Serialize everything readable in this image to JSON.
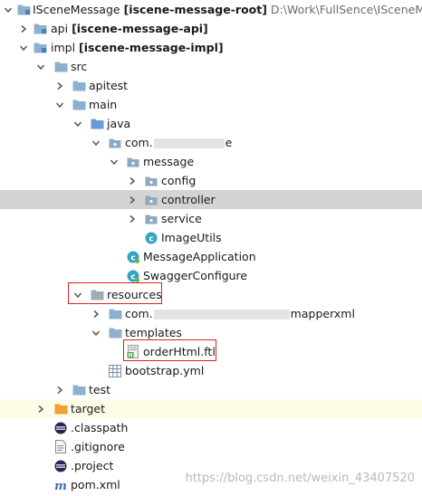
{
  "colors": {
    "folder": "#8fb0cc",
    "source_folder": "#6b9bd6",
    "package": "#8ea8bf",
    "resources_folder": "#c7a76a",
    "excluded_folder": "#f0a030",
    "class_icon": "#34a4c4",
    "selection": "#d4d4d4",
    "highlight_box": "#d82121"
  },
  "tree": {
    "root": {
      "name": "ISceneMessage",
      "module": "[iscene-message-root]",
      "path": "D:\\Work\\FullSence\\ISceneMessa"
    },
    "api": {
      "name": "api",
      "module": "[iscene-message-api]"
    },
    "impl": {
      "name": "impl",
      "module": "[iscene-message-impl]"
    },
    "src": "src",
    "apitest": "apitest",
    "main": "main",
    "java": "java",
    "com_prefix": "com.",
    "com_suffix": "e",
    "message": "message",
    "config": "config",
    "controller": "controller",
    "service": "service",
    "image_utils": "ImageUtils",
    "message_application": "MessageApplication",
    "swagger_configure": "SwaggerConfigure",
    "resources": "resources",
    "mapper_prefix": "com.",
    "mapper_suffix": "mapperxml",
    "templates": "templates",
    "order_html": "orderHtml.ftl",
    "bootstrap": "bootstrap.yml",
    "test": "test",
    "target": "target",
    "classpath": ".classpath",
    "gitignore": ".gitignore",
    "project": ".project",
    "pom": "pom.xml"
  },
  "icons": {
    "expanded": "chevron-down-icon",
    "collapsed": "chevron-right-icon",
    "class": "class-c-icon",
    "spring_class": "spring-class-icon",
    "ftl": "ftl-file-icon",
    "yml": "yml-file-icon",
    "eclipse": "eclipse-file-icon",
    "maven": "maven-m-icon"
  },
  "watermark": "https://blog.csdn.net/weixin_43407520"
}
